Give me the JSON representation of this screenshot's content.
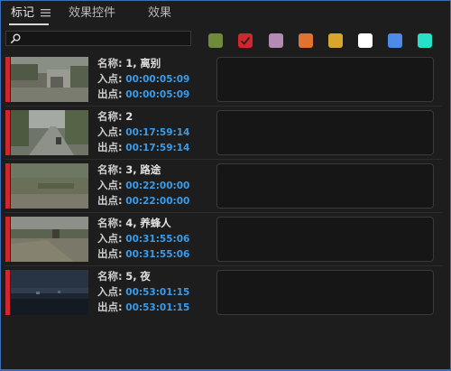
{
  "tabs": [
    {
      "label": "标记",
      "active": true
    },
    {
      "label": "效果控件",
      "active": false
    },
    {
      "label": "效果",
      "active": false
    }
  ],
  "search": {
    "value": "",
    "placeholder": ""
  },
  "swatches": [
    {
      "name": "green",
      "color": "#6f8a3a",
      "selected": false
    },
    {
      "name": "red",
      "color": "#d0262d",
      "selected": true
    },
    {
      "name": "violet",
      "color": "#b48bb5",
      "selected": false
    },
    {
      "name": "orange",
      "color": "#e2722f",
      "selected": false
    },
    {
      "name": "yellow",
      "color": "#d6a72f",
      "selected": false
    },
    {
      "name": "white",
      "color": "#ffffff",
      "selected": false
    },
    {
      "name": "blue",
      "color": "#4c8ce8",
      "selected": false
    },
    {
      "name": "cyan",
      "color": "#27e0c8",
      "selected": false
    }
  ],
  "labels": {
    "name": "名称:",
    "in": "入点:",
    "out": "出点:"
  },
  "markers": [
    {
      "name_num": "1,",
      "name_text": "离别",
      "in": "00:00:05:09",
      "out": "00:00:05:09",
      "thumb": "village-road",
      "comment": ""
    },
    {
      "name_num": "2",
      "name_text": "",
      "in": "00:17:59:14",
      "out": "00:17:59:14",
      "thumb": "tree-lined-road",
      "comment": ""
    },
    {
      "name_num": "3,",
      "name_text": "路途",
      "in": "00:22:00:00",
      "out": "00:22:00:00",
      "thumb": "hillside",
      "comment": ""
    },
    {
      "name_num": "4,",
      "name_text": "养蜂人",
      "in": "00:31:55:06",
      "out": "00:31:55:06",
      "thumb": "field-path",
      "comment": ""
    },
    {
      "name_num": "5,",
      "name_text": "夜",
      "in": "00:53:01:15",
      "out": "00:53:01:15",
      "thumb": "night-scene",
      "comment": ""
    }
  ],
  "colors": {
    "marker_red": "#d0262d",
    "timecode_blue": "#3a9bea",
    "panel_bg": "#1d1d1d"
  }
}
